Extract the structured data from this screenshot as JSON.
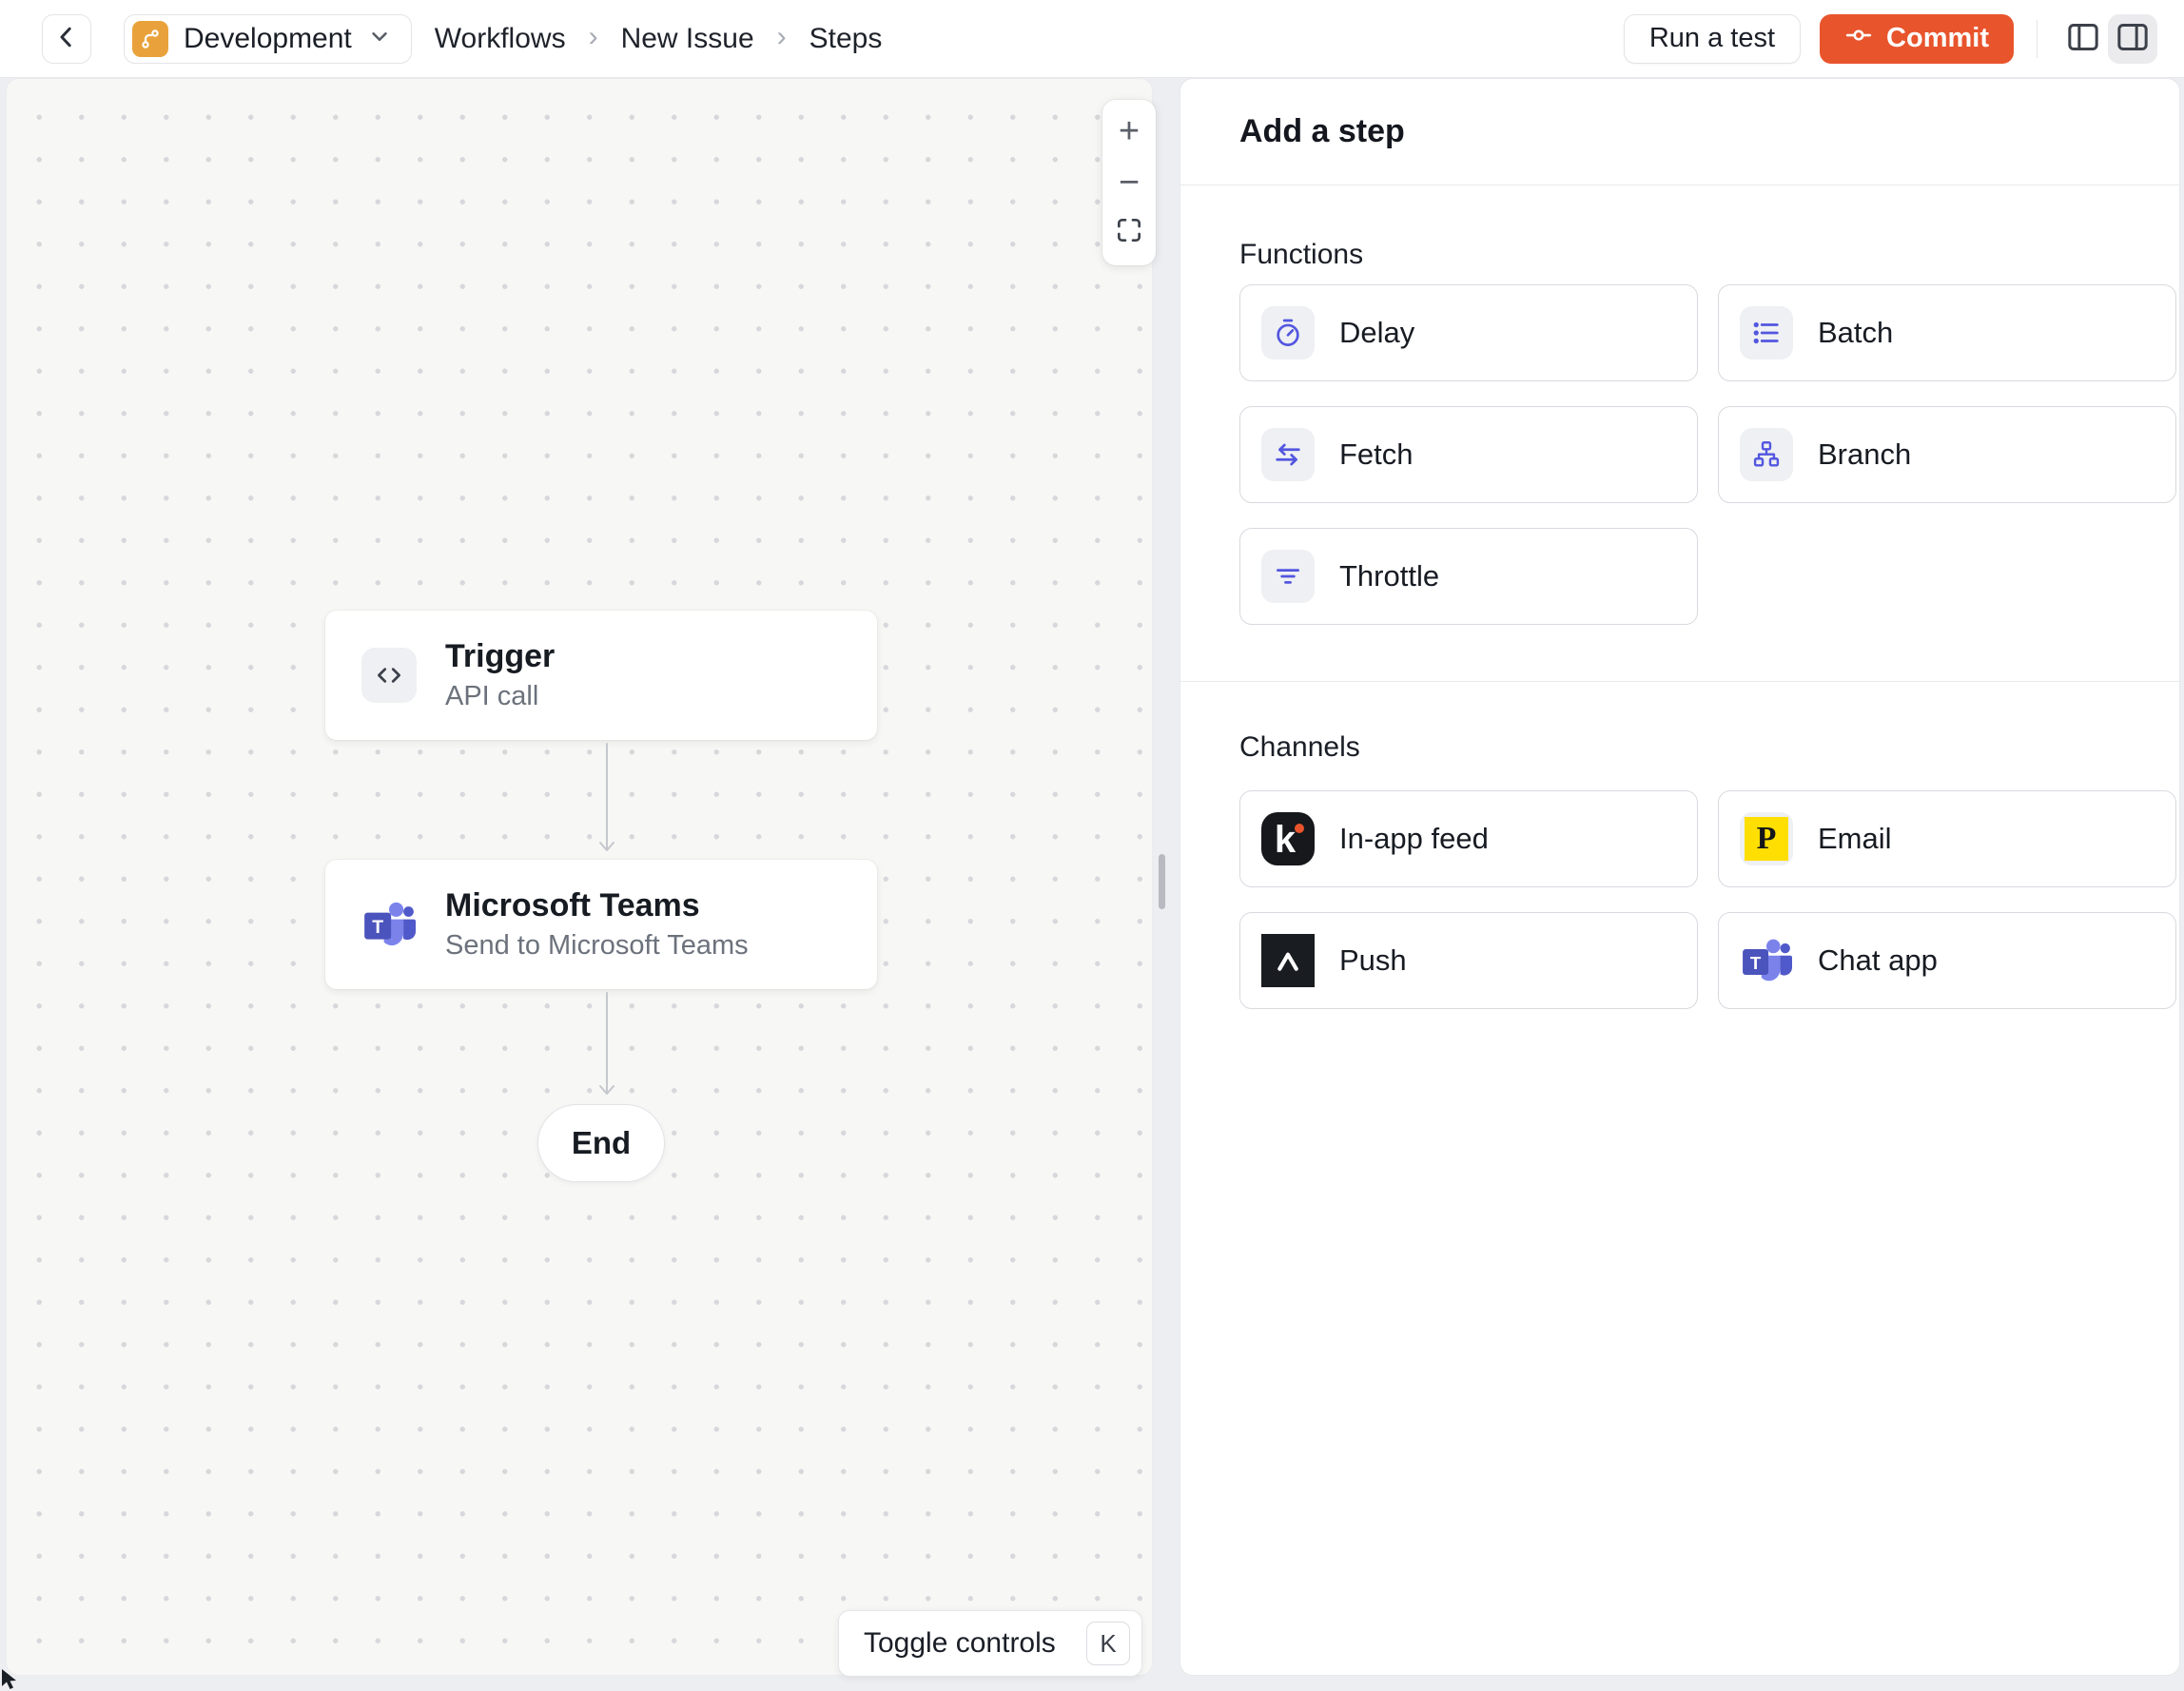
{
  "header": {
    "back_button": {
      "icon": "chevron-left-icon"
    },
    "environment_switcher": {
      "label": "Development",
      "icon": "git-branch-icon",
      "icon_color": "#E9A23B"
    },
    "breadcrumbs": {
      "items": [
        "Workflows",
        "New Issue",
        "Steps"
      ],
      "separator": "›"
    },
    "actions": {
      "run_test": "Run a test",
      "commit": "Commit"
    },
    "panel_toggles": {
      "left": "toggle-left-panel-icon",
      "right": "toggle-right-panel-icon",
      "right_active": true
    }
  },
  "canvas": {
    "zoom_controls": {
      "zoom_in": "+",
      "zoom_out": "−",
      "fit": "fit-view-icon"
    },
    "nodes": {
      "trigger": {
        "title": "Trigger",
        "subtitle": "API call",
        "icon": "code-icon"
      },
      "teams": {
        "title": "Microsoft Teams",
        "subtitle": "Send to Microsoft Teams",
        "icon": "microsoft-teams-icon"
      },
      "end": {
        "label": "End"
      }
    },
    "toggle_controls": {
      "label": "Toggle controls",
      "shortcut": "K"
    }
  },
  "panel": {
    "title": "Add a step",
    "functions": {
      "label": "Functions",
      "tiles": [
        {
          "label": "Delay",
          "icon": "stopwatch-icon"
        },
        {
          "label": "Batch",
          "icon": "queue-list-icon"
        },
        {
          "label": "Fetch",
          "icon": "arrows-swap-icon"
        },
        {
          "label": "Branch",
          "icon": "hierarchy-icon"
        },
        {
          "label": "Throttle",
          "icon": "filter-lines-icon"
        }
      ]
    },
    "channels": {
      "label": "Channels",
      "tiles": [
        {
          "label": "In-app feed",
          "icon": "knock-icon"
        },
        {
          "label": "Email",
          "icon": "postmark-icon"
        },
        {
          "label": "Push",
          "icon": "expo-icon"
        },
        {
          "label": "Chat app",
          "icon": "microsoft-teams-icon"
        }
      ]
    }
  },
  "colors": {
    "accent_commit": "#E8542C",
    "environment_badge": "#E9A23B",
    "function_icon": "#5356DF",
    "postmark_yellow": "#FFDE02",
    "canvas_background": "#F7F7F5",
    "teams_purple_dark": "#4B53BC",
    "teams_purple_light": "#7B83EB"
  }
}
